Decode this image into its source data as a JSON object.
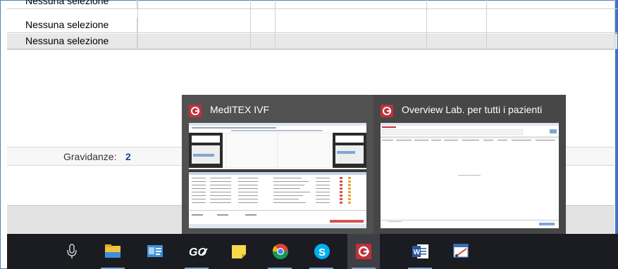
{
  "grid": {
    "rows": [
      {
        "value": "Nessuna selezione"
      },
      {
        "value": "Nessuna selezione"
      },
      {
        "value": "Nessuna selezione"
      }
    ]
  },
  "summary": {
    "pregnancies_label": "Gravidanze:",
    "pregnancies_value": "2"
  },
  "preview": {
    "windows": [
      {
        "title": "MedITEX IVF"
      },
      {
        "title": "Overview Lab. per tutti i pazienti"
      }
    ]
  },
  "taskbar": {
    "items": [
      {
        "icon": "microphone-icon"
      },
      {
        "icon": "file-explorer-icon"
      },
      {
        "icon": "contacts-card-icon"
      },
      {
        "icon": "goto-icon"
      },
      {
        "icon": "sticky-notes-icon"
      },
      {
        "icon": "chrome-icon"
      },
      {
        "icon": "skype-icon"
      },
      {
        "icon": "meditex-icon"
      },
      {
        "icon": "word-icon"
      },
      {
        "icon": "snipping-tool-icon"
      }
    ],
    "active": "meditex-icon",
    "colors": {
      "bar": "#1a1c22",
      "active": "#3d3f45",
      "underline": "#7fa6d9"
    }
  }
}
